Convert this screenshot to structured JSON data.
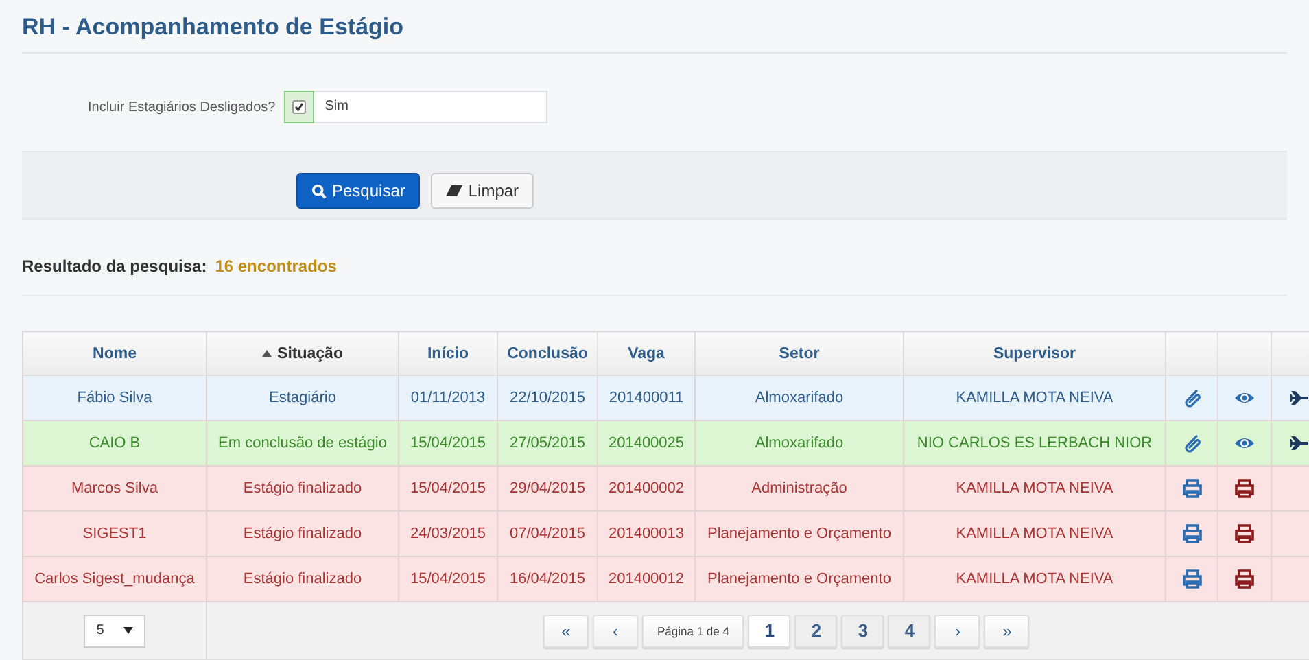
{
  "title": "RH - Acompanhamento de Estágio",
  "filter": {
    "label": "Incluir Estagiários Desligados?",
    "checked": true,
    "value": "Sim"
  },
  "buttons": [
    {
      "kind": "search",
      "label": "Pesquisar"
    },
    {
      "kind": "clear",
      "label": "Limpar"
    }
  ],
  "result": {
    "label": "Resultado da pesquisa:",
    "count": "16 encontrados"
  },
  "table": {
    "columns": [
      {
        "label": "Nome",
        "sorted": false
      },
      {
        "label": "Situação",
        "sorted": true
      },
      {
        "label": "Início",
        "sorted": false
      },
      {
        "label": "Conclusão",
        "sorted": false
      },
      {
        "label": "Vaga",
        "sorted": false
      },
      {
        "label": "Setor",
        "sorted": false
      },
      {
        "label": "Supervisor",
        "sorted": false
      }
    ],
    "rows": [
      {
        "kind": "active",
        "cells": [
          "Fábio Silva",
          "Estagiário",
          "01/11/2013",
          "22/10/2015",
          "201400011",
          "Almoxarifado",
          "KAMILLA MOTA NEIVA"
        ],
        "actions": [
          {
            "kind": "clip"
          },
          {
            "kind": "view"
          },
          {
            "kind": "plane"
          }
        ]
      },
      {
        "kind": "concluding",
        "cells": [
          "CAIO B",
          "Em conclusão de estágio",
          "15/04/2015",
          "27/05/2015",
          "201400025",
          "Almoxarifado",
          "NIO CARLOS ES LERBACH NIOR"
        ],
        "actions": [
          {
            "kind": "clip"
          },
          {
            "kind": "view"
          },
          {
            "kind": "plane"
          }
        ]
      },
      {
        "kind": "finished",
        "cells": [
          "Marcos Silva",
          "Estágio finalizado",
          "15/04/2015",
          "29/04/2015",
          "201400002",
          "Administração",
          "KAMILLA MOTA NEIVA"
        ],
        "actions": [
          {
            "kind": "print"
          },
          {
            "kind": "print-red"
          }
        ]
      },
      {
        "kind": "finished",
        "cells": [
          "SIGEST1",
          "Estágio finalizado",
          "24/03/2015",
          "07/04/2015",
          "201400013",
          "Planejamento e Orçamento",
          "KAMILLA MOTA NEIVA"
        ],
        "actions": [
          {
            "kind": "print"
          },
          {
            "kind": "print-red"
          }
        ]
      },
      {
        "kind": "finished",
        "cells": [
          "Carlos Sigest_mudança",
          "Estágio finalizado",
          "15/04/2015",
          "16/04/2015",
          "201400012",
          "Planejamento e Orçamento",
          "KAMILLA MOTA NEIVA"
        ],
        "actions": [
          {
            "kind": "print"
          },
          {
            "kind": "print-red"
          }
        ]
      }
    ],
    "page_size": "5",
    "pager": {
      "first": "«",
      "prev": "‹",
      "info": "Página 1 de 4",
      "pages": [
        {
          "label": "1",
          "selected": true
        },
        {
          "label": "2",
          "selected": false
        },
        {
          "label": "3",
          "selected": false
        },
        {
          "label": "4",
          "selected": false
        }
      ],
      "next": "›",
      "last": "»"
    }
  }
}
